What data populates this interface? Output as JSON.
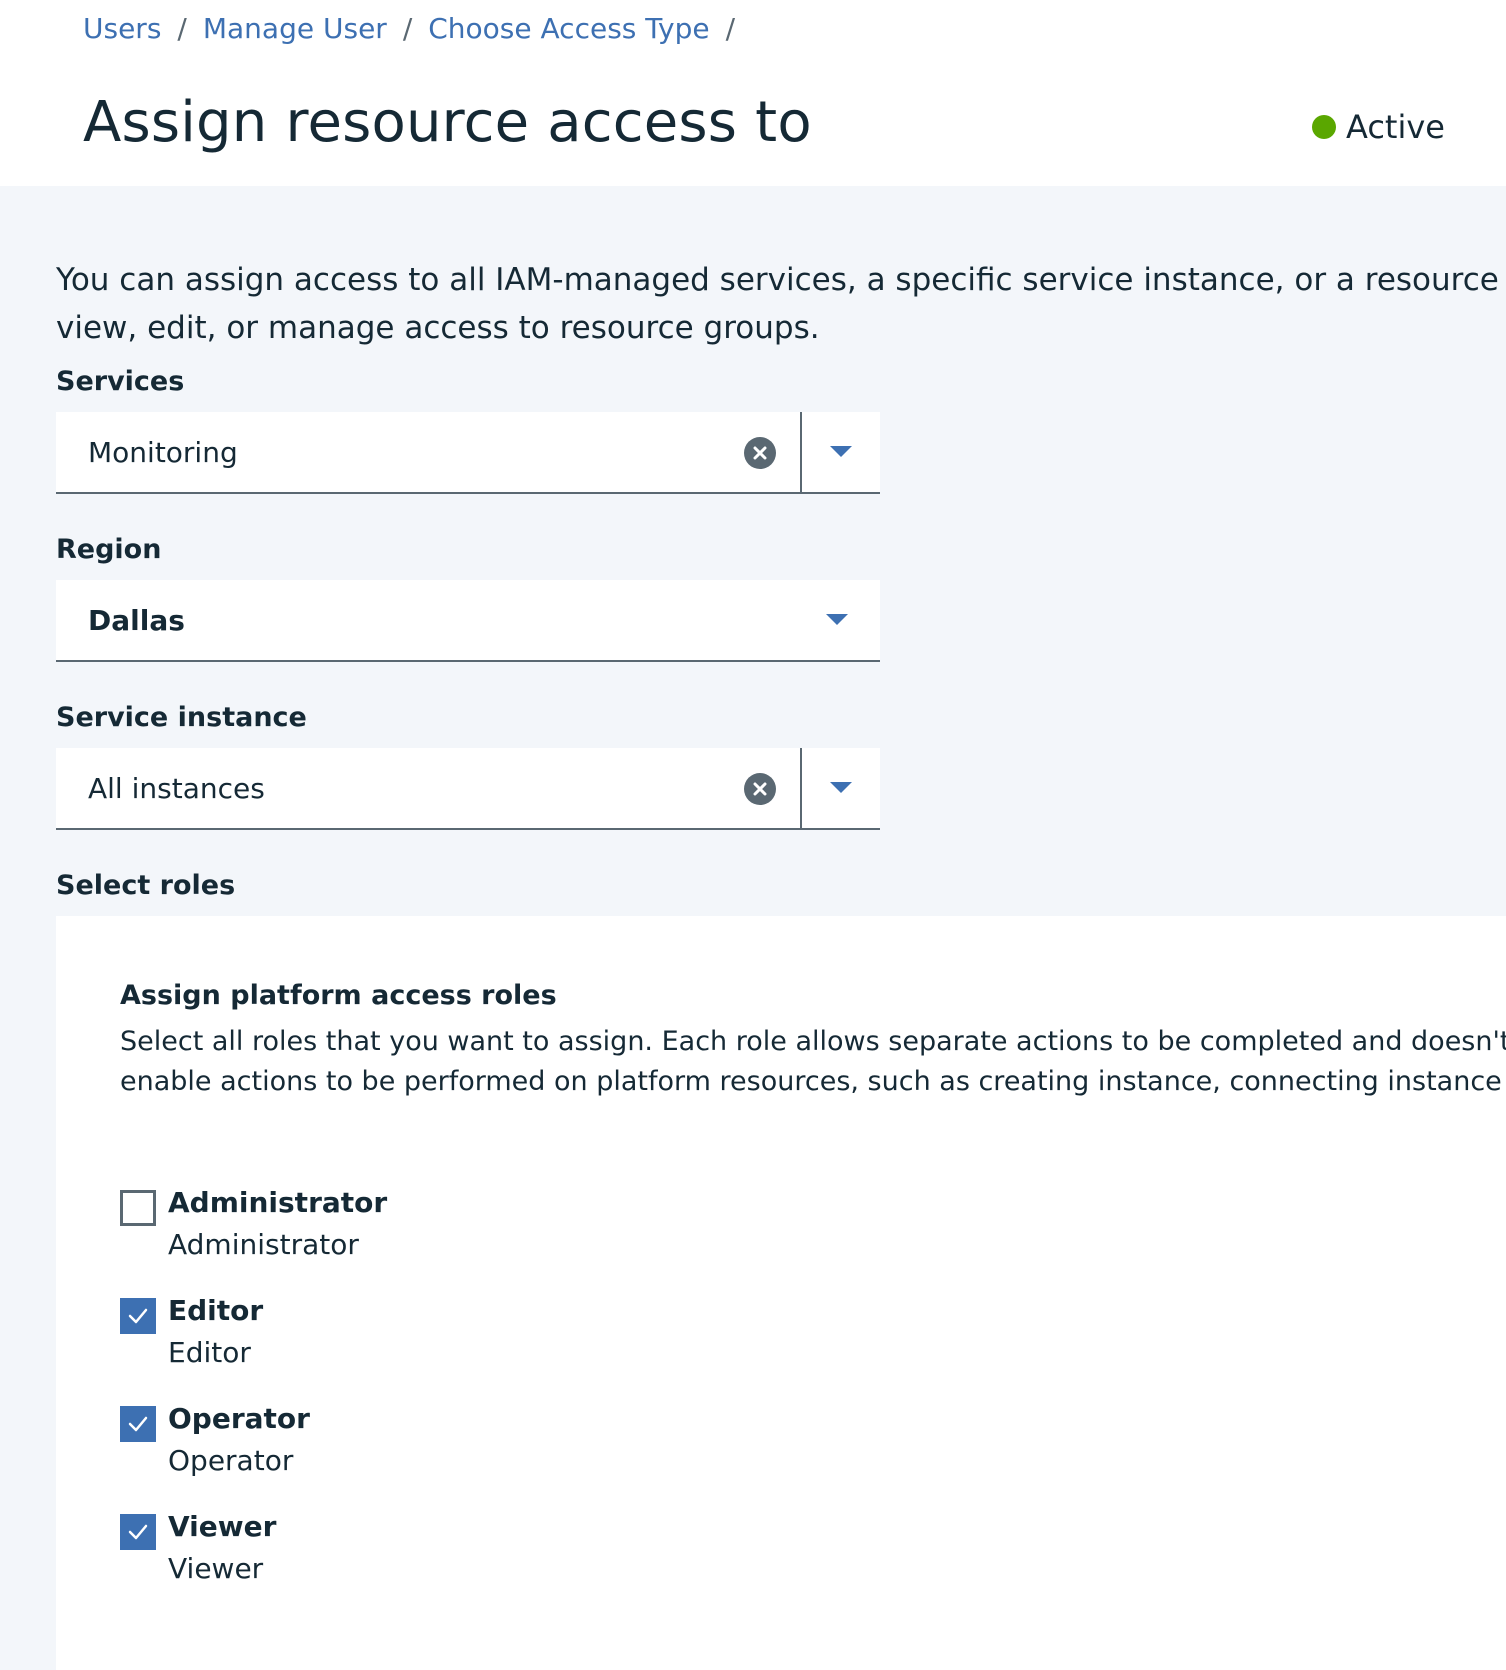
{
  "breadcrumb": {
    "items": [
      "Users",
      "Manage User",
      "Choose Access Type"
    ],
    "separator": "/"
  },
  "page": {
    "title": "Assign resource access to",
    "status": "Active",
    "status_color": "#5aa700"
  },
  "intro": {
    "line1": "You can assign access to all IAM-managed services, a specific service instance, or a resource within a",
    "line2": "view, edit, or manage access to resource groups."
  },
  "services": {
    "label": "Services",
    "value": "Monitoring"
  },
  "region": {
    "label": "Region",
    "value": "Dallas"
  },
  "service_instance": {
    "label": "Service instance",
    "value": "All instances"
  },
  "roles": {
    "section_label": "Select roles",
    "heading": "Assign platform access roles",
    "desc_line1": "Select all roles that you want to assign. Each role allows separate actions to be completed and doesn't inherit th",
    "desc_line2": "enable actions to be performed on platform resources, such as creating instance, connecting instance to apps,",
    "items": [
      {
        "name": "Administrator",
        "description": "Administrator",
        "checked": false
      },
      {
        "name": "Editor",
        "description": "Editor",
        "checked": true
      },
      {
        "name": "Operator",
        "description": "Operator",
        "checked": true
      },
      {
        "name": "Viewer",
        "description": "Viewer",
        "checked": true
      }
    ]
  },
  "colors": {
    "link": "#3d70b2",
    "checkbox_checked": "#3d70b2",
    "status_active": "#5aa700"
  }
}
